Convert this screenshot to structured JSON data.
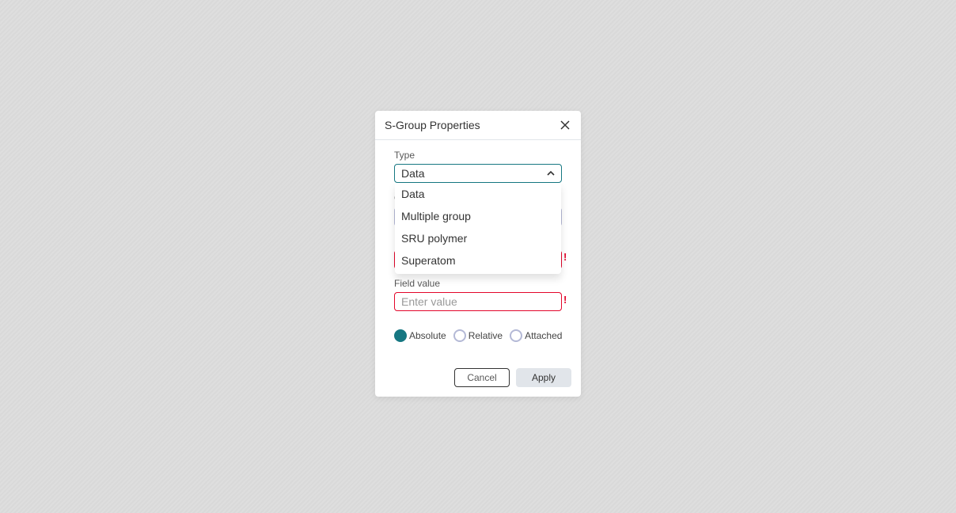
{
  "dialog": {
    "title": "S-Group Properties",
    "type": {
      "label": "Type",
      "value": "Data",
      "options": [
        "Data",
        "Multiple group",
        "SRU polymer",
        "Superatom"
      ]
    },
    "context": {
      "label": "C"
    },
    "field_name": {
      "error_mark": "!"
    },
    "field_value": {
      "label": "Field value",
      "placeholder": "Enter value",
      "error_mark": "!"
    },
    "positioning": {
      "options": [
        "Absolute",
        "Relative",
        "Attached"
      ],
      "selected": "Absolute"
    },
    "cancel_label": "Cancel",
    "apply_label": "Apply"
  },
  "colors": {
    "accent": "#167782",
    "error": "#e3052a"
  }
}
